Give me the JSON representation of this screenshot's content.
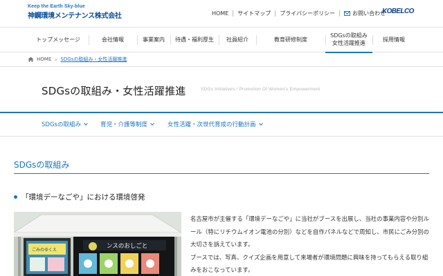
{
  "header": {
    "logo_tagline": "Keep the Earth Sky-blue",
    "logo_name": "神鋼環境メンテナンス株式会社",
    "utility_links": [
      "HOME",
      "サイトマップ",
      "プライバシーポリシー"
    ],
    "contact_label": "お問い合わせ",
    "brand": "KOBELCO"
  },
  "nav": {
    "items": [
      {
        "label": "トップメッセージ"
      },
      {
        "label": "会社情報"
      },
      {
        "label": "事業案内"
      },
      {
        "label": "待遇・福利厚生"
      },
      {
        "label": "社員紹介"
      },
      {
        "label": "教育研修制度"
      },
      {
        "label_line1": "SDGsの取組み",
        "label_line2": "女性活躍推進",
        "active": true
      },
      {
        "label": "採用情報"
      }
    ]
  },
  "breadcrumb": {
    "home": "HOME",
    "current": "SDGsの取組み・女性活躍推進"
  },
  "page": {
    "title": "SDGsの取組み・女性活躍推進",
    "subtitle": "SDGs Initiatives / Promotion Of Women's Empowerment"
  },
  "subnav": [
    "SDGsの取組み",
    "育児・介護等制度",
    "女性活躍・次世代育成の行動計画"
  ],
  "content": {
    "section_title": "SDGsの取組み",
    "item_title": "「環境デーなごや」における環境啓発",
    "photo_sign": "ンスのおしごと",
    "photo_panel_left": "ごみのゆくえ",
    "paragraphs": [
      "名古屋市が主催する「環境デーなごや」に当社がブースを出展し、当社の事業内容や分別ルール（特にリチウムイオン電池の分別）などを自作パネルなどで周知し、市民にごみ分別の大切さを訴えています。",
      "ブースでは、写真、クイズ企画を用意して来場者が環境問題に興味を持ってもらえる取り組みをおこなっています。"
    ]
  },
  "colors": {
    "accent": "#1a75c2",
    "brand_dark": "#0b3f8f"
  }
}
